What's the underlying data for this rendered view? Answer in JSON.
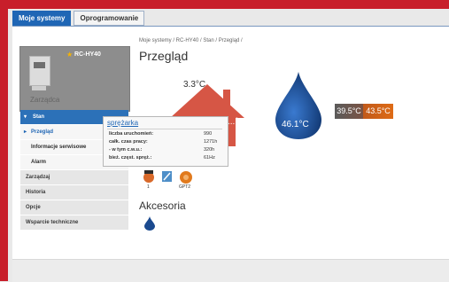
{
  "tabs": {
    "my_systems": "Moje systemy",
    "software": "Oprogramowanie"
  },
  "device": {
    "name": "RC-HY40",
    "manage_text": "Zarządca"
  },
  "menu": {
    "stan": "Stan",
    "overview": "Przegląd",
    "service_info": "Informacje serwisowe",
    "alarm": "Alarm",
    "manage": "Zarządzaj",
    "history": "Historia",
    "options": "Opcje",
    "support": "Wsparcie techniczne"
  },
  "breadcrumb": "Moje systemy / RC-HY40 / Stan / Przegląd /",
  "page_title": "Przegląd",
  "temps": {
    "outside": "3.3°C",
    "house": "...°C",
    "tank": "46.1°C",
    "badge_left": "39.5°C",
    "badge_right": "43.5°C"
  },
  "popup": {
    "title": "sprężarka",
    "rows": [
      {
        "label": "liczba uruchomień:",
        "value": "990"
      },
      {
        "label": "całk. czas pracy:",
        "value": "1271h"
      },
      {
        "label": "- w tym c.w.u.:",
        "value": "320h"
      },
      {
        "label": "bież. częst. spręż.:",
        "value": "61Hz"
      }
    ]
  },
  "icons_row": {
    "label_1": "1",
    "label_2": "GPT2"
  },
  "accessories_title": "Akcesoria",
  "colors": {
    "frame_red": "#c81e2a",
    "accent_blue": "#1f66b5",
    "house_red": "#d65645",
    "drop_blue": "#1b4a8f"
  }
}
